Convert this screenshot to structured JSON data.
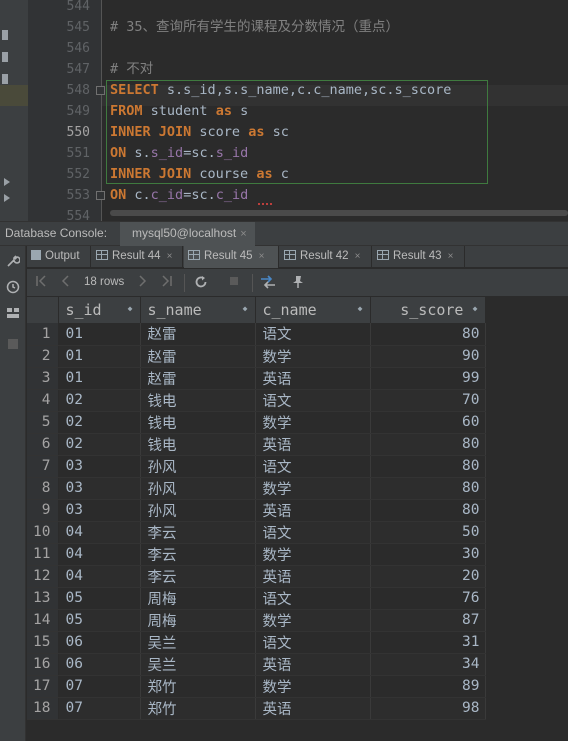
{
  "editor": {
    "lines": [
      {
        "num": "544",
        "text": ""
      },
      {
        "num": "545",
        "text": "# 35、查询所有学生的课程及分数情况（重点）"
      },
      {
        "num": "546",
        "text": ""
      },
      {
        "num": "547",
        "text": "# 不对"
      },
      {
        "num": "548",
        "kw": "SELECT",
        "rest_fields": "s.s_id,s.s_name,c.c_name,sc.s_score"
      },
      {
        "num": "549",
        "kw": "FROM",
        "t1": "student",
        "kw2": "as",
        "t2": "s"
      },
      {
        "num": "550",
        "kw": "INNER JOIN",
        "t1": "score",
        "kw2": "as",
        "t2": "sc"
      },
      {
        "num": "551",
        "kw": "ON",
        "t1": "s.",
        "f1": "s_id",
        "t2": "=sc.",
        "f2": "s_id"
      },
      {
        "num": "552",
        "kw": "INNER JOIN",
        "t1": "course",
        "kw2": "as",
        "t2": "c"
      },
      {
        "num": "553",
        "kw": "ON",
        "t1": "c.",
        "f1": "c_id",
        "t2": "=sc.",
        "f2": "c_id"
      },
      {
        "num": "554",
        "text": ""
      }
    ]
  },
  "console": {
    "label": "Database Console:",
    "tab": "mysql50@localhost",
    "close": "×"
  },
  "result_tabs": [
    {
      "label": "Output",
      "type": "output"
    },
    {
      "label": "Result 44",
      "type": "result",
      "close": "×"
    },
    {
      "label": "Result 45",
      "type": "result",
      "close": "×",
      "active": true
    },
    {
      "label": "Result 42",
      "type": "result",
      "close": "×"
    },
    {
      "label": "Result 43",
      "type": "result",
      "close": "×"
    }
  ],
  "toolbar": {
    "rows": "18 rows",
    "first_icon": "first-page-icon",
    "prev_icon": "prev-page-icon",
    "next_icon": "next-page-icon",
    "last_icon": "last-page-icon",
    "refresh_icon": "refresh-icon",
    "stop_icon": "stop-icon",
    "compare_icon": "compare-icon",
    "pin_icon": "pin-icon"
  },
  "grid": {
    "columns": [
      "s_id",
      "s_name",
      "c_name",
      "s_score"
    ],
    "rows": [
      [
        "1",
        "01",
        "赵雷",
        "语文",
        "80"
      ],
      [
        "2",
        "01",
        "赵雷",
        "数学",
        "90"
      ],
      [
        "3",
        "01",
        "赵雷",
        "英语",
        "99"
      ],
      [
        "4",
        "02",
        "钱电",
        "语文",
        "70"
      ],
      [
        "5",
        "02",
        "钱电",
        "数学",
        "60"
      ],
      [
        "6",
        "02",
        "钱电",
        "英语",
        "80"
      ],
      [
        "7",
        "03",
        "孙风",
        "语文",
        "80"
      ],
      [
        "8",
        "03",
        "孙风",
        "数学",
        "80"
      ],
      [
        "9",
        "03",
        "孙风",
        "英语",
        "80"
      ],
      [
        "10",
        "04",
        "李云",
        "语文",
        "50"
      ],
      [
        "11",
        "04",
        "李云",
        "数学",
        "30"
      ],
      [
        "12",
        "04",
        "李云",
        "英语",
        "20"
      ],
      [
        "13",
        "05",
        "周梅",
        "语文",
        "76"
      ],
      [
        "14",
        "05",
        "周梅",
        "数学",
        "87"
      ],
      [
        "15",
        "06",
        "吴兰",
        "语文",
        "31"
      ],
      [
        "16",
        "06",
        "吴兰",
        "英语",
        "34"
      ],
      [
        "17",
        "07",
        "郑竹",
        "数学",
        "89"
      ],
      [
        "18",
        "07",
        "郑竹",
        "英语",
        "98"
      ]
    ]
  },
  "colors": {
    "background": "#2b2b2b",
    "keyword": "#cc7832",
    "field": "#9876aa",
    "comment": "#808080",
    "text": "#a9b7c6"
  }
}
